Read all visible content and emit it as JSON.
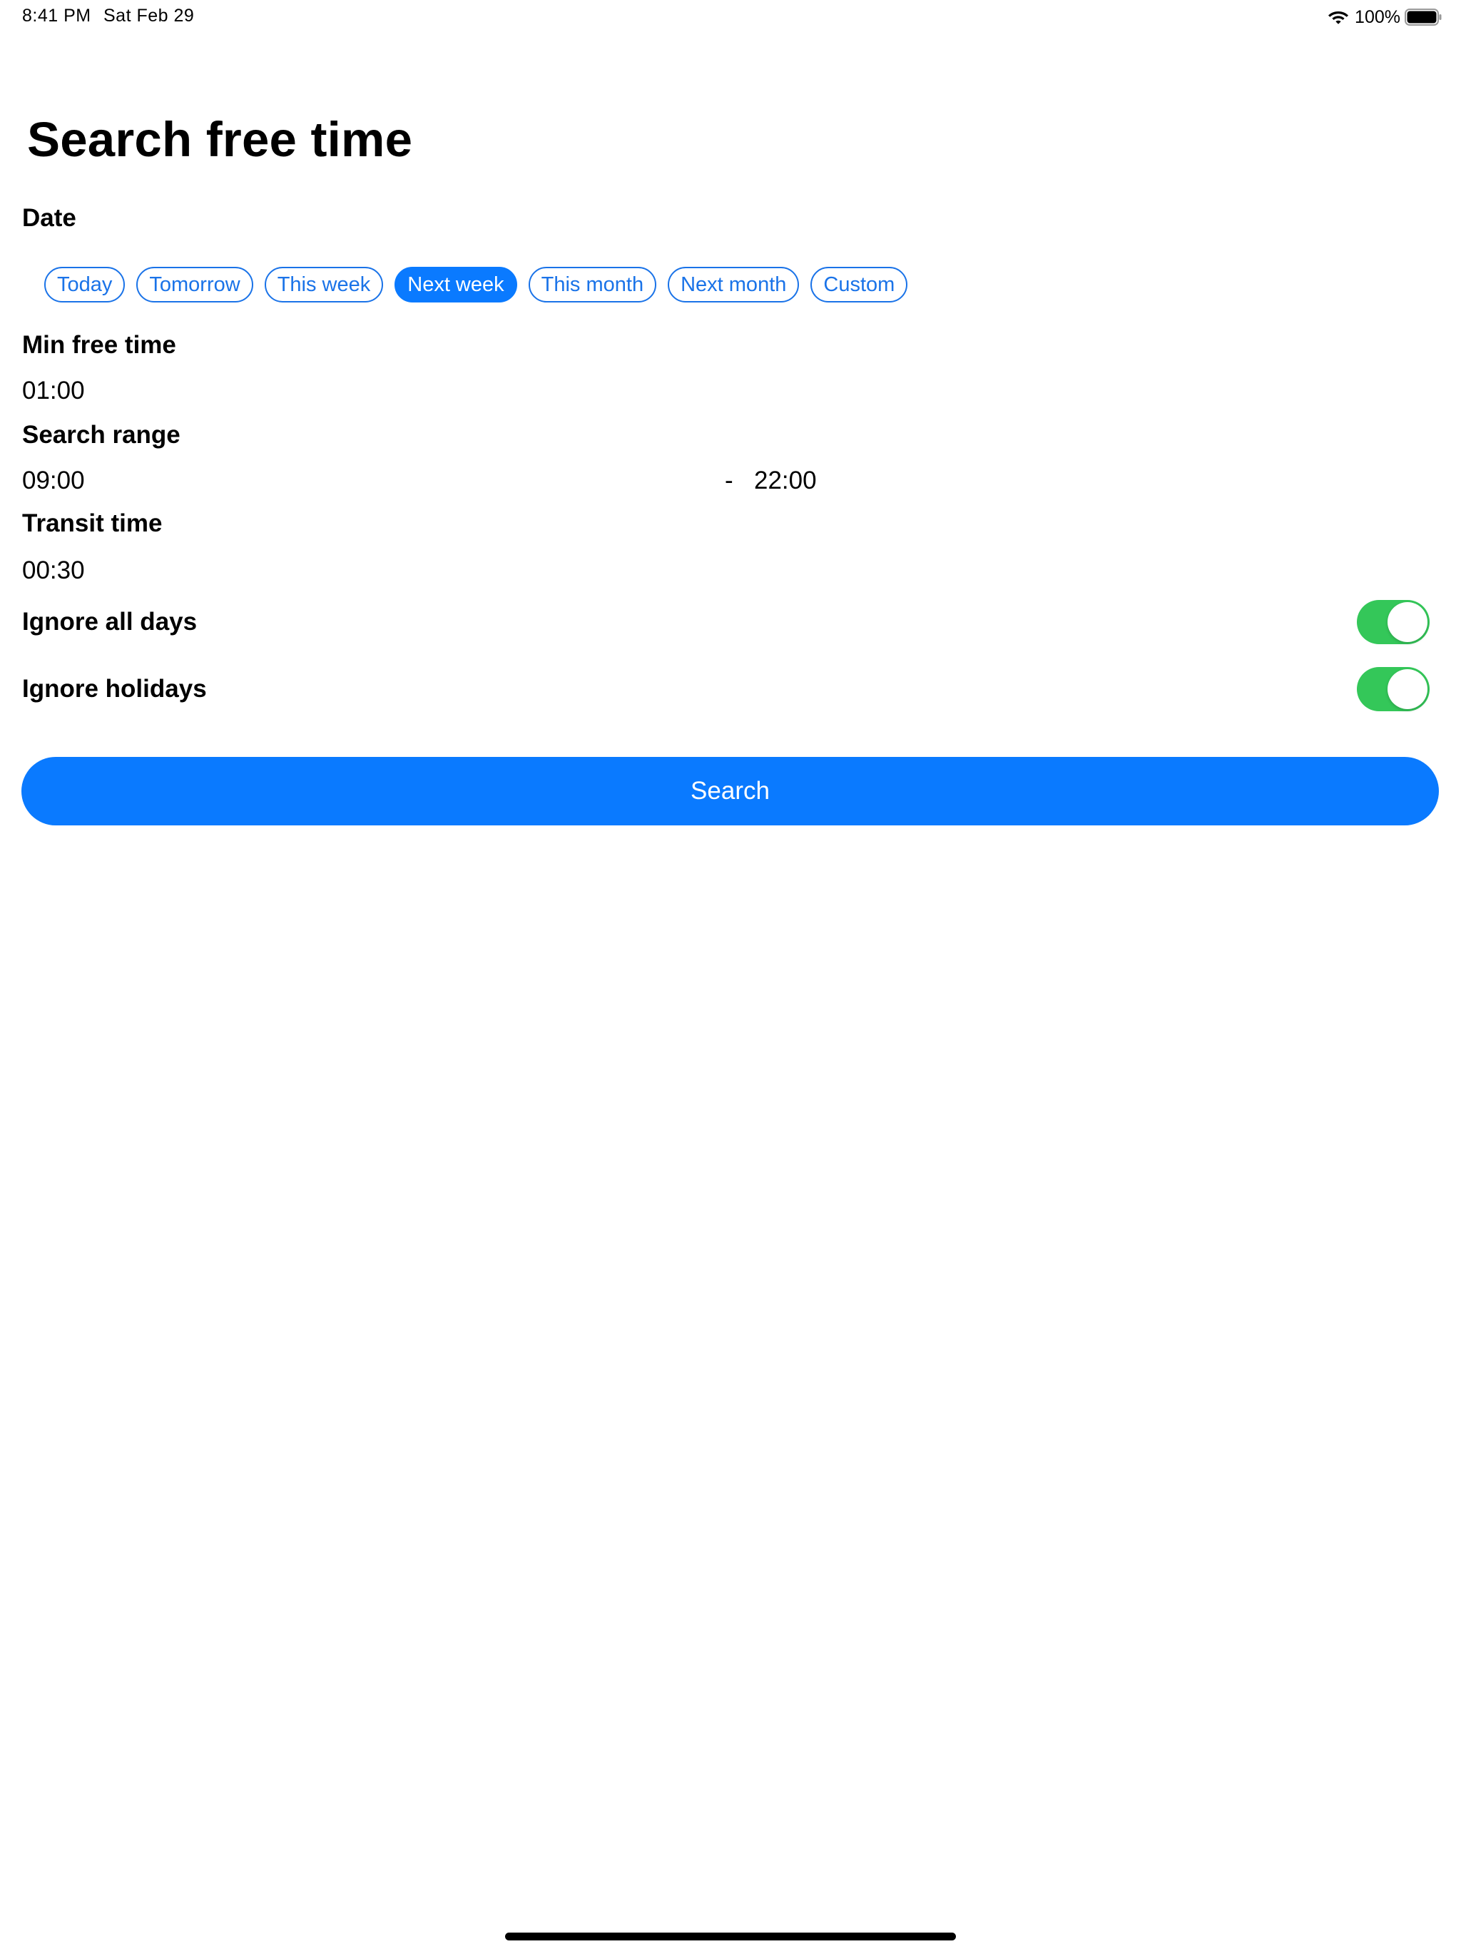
{
  "status_bar": {
    "time": "8:41 PM",
    "date": "Sat Feb 29",
    "battery_percent": "100%",
    "icons": [
      "wifi-icon",
      "battery-icon"
    ]
  },
  "page": {
    "title": "Search free time"
  },
  "date_section": {
    "label": "Date",
    "options": [
      {
        "label": "Today",
        "selected": false
      },
      {
        "label": "Tomorrow",
        "selected": false
      },
      {
        "label": "This week",
        "selected": false
      },
      {
        "label": "Next week",
        "selected": true
      },
      {
        "label": "This month",
        "selected": false
      },
      {
        "label": "Next month",
        "selected": false
      },
      {
        "label": "Custom",
        "selected": false
      }
    ]
  },
  "min_free_time": {
    "label": "Min free time",
    "value": "01:00"
  },
  "search_range": {
    "label": "Search range",
    "start": "09:00",
    "separator": "-",
    "end": "22:00"
  },
  "transit_time": {
    "label": "Transit time",
    "value": "00:30"
  },
  "ignore_all_days": {
    "label": "Ignore all days",
    "on": true
  },
  "ignore_holidays": {
    "label": "Ignore holidays",
    "on": true
  },
  "search_button": {
    "label": "Search"
  },
  "colors": {
    "accent": "#0a7aff",
    "chip_border": "#1a73e8",
    "toggle_on": "#34c759"
  }
}
